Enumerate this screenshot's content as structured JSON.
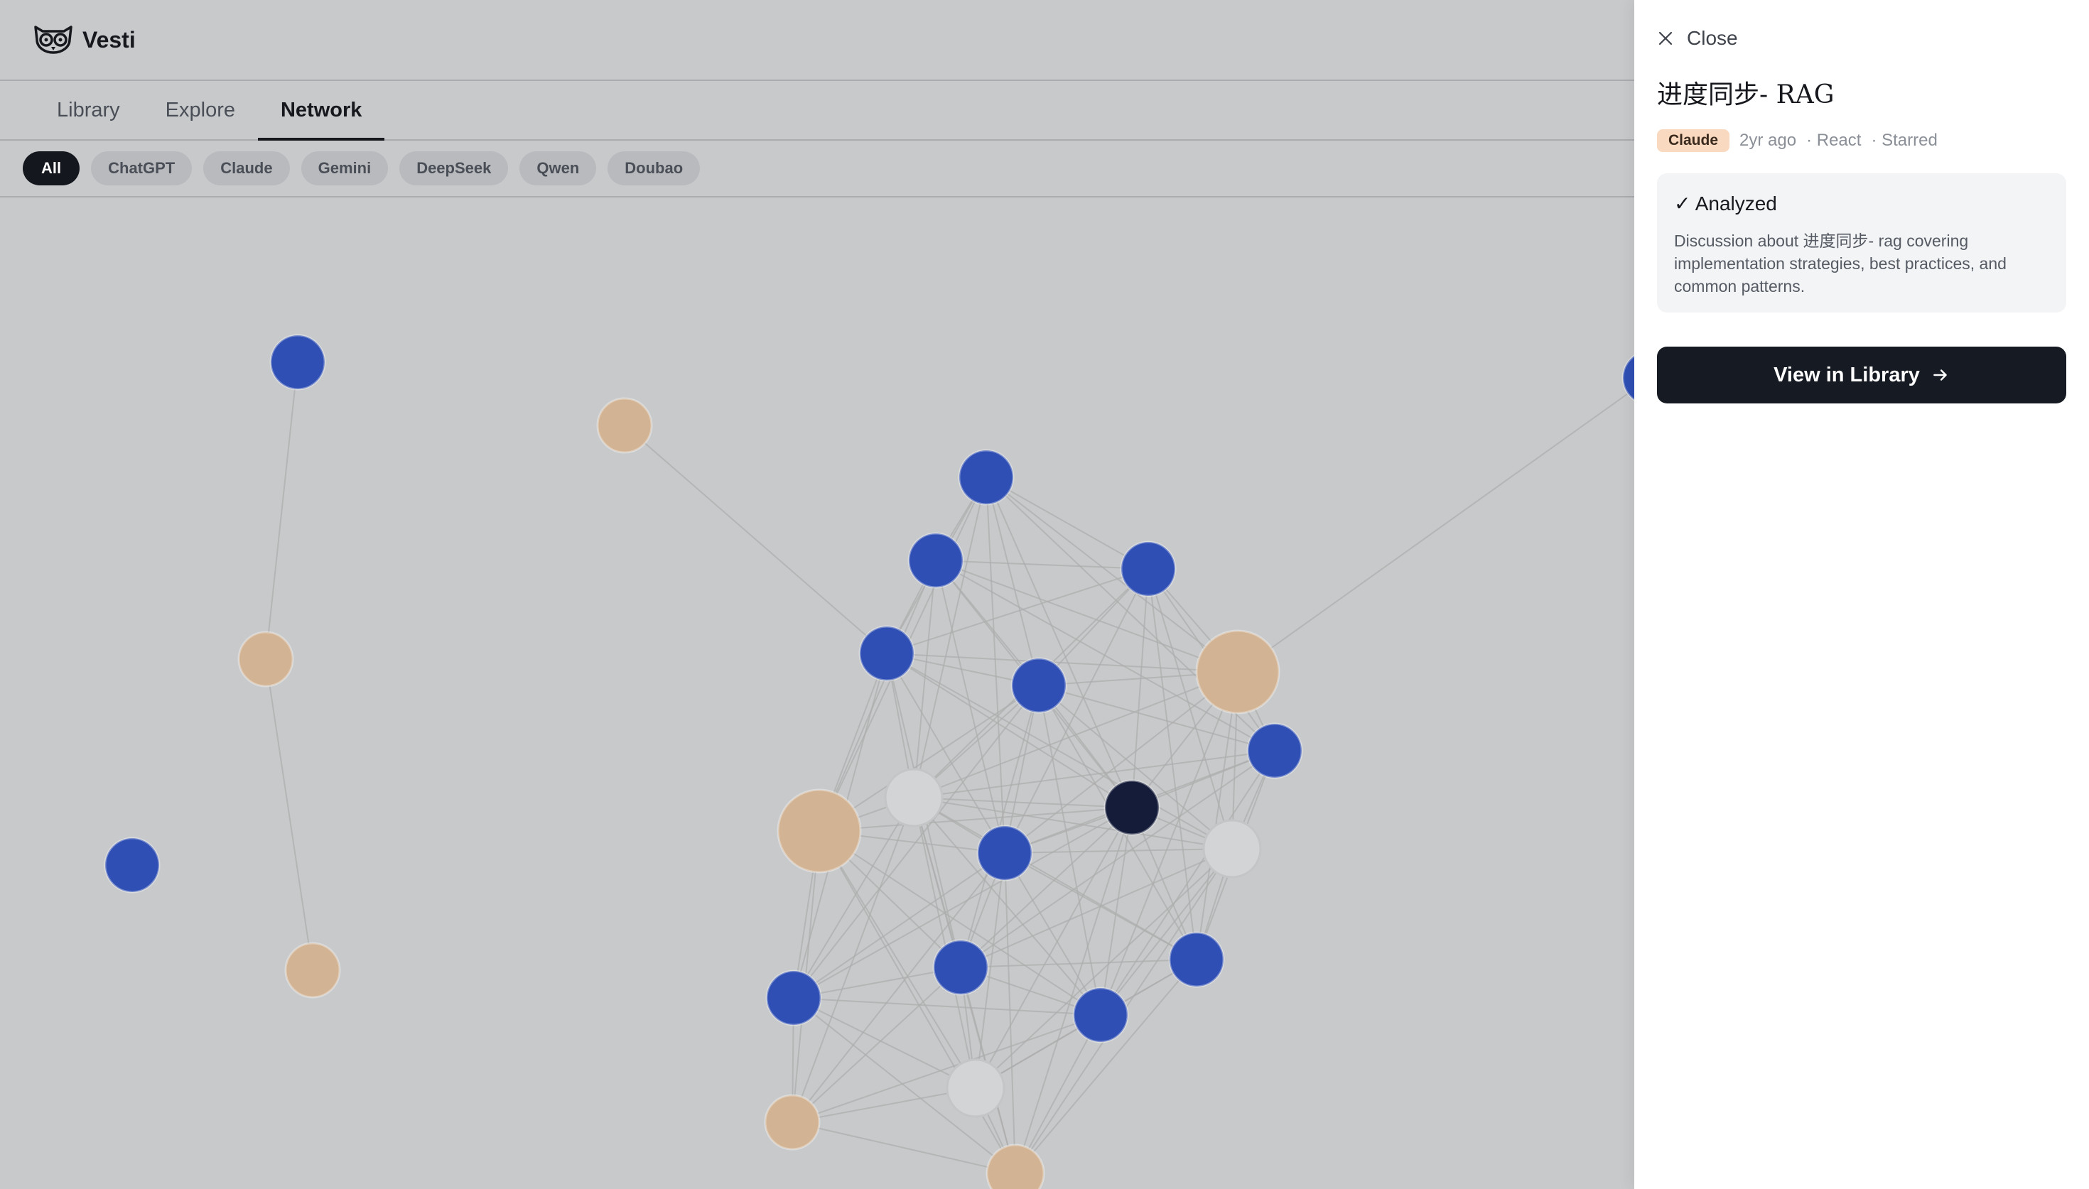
{
  "app": {
    "name": "Vesti"
  },
  "tabs": [
    {
      "label": "Library"
    },
    {
      "label": "Explore"
    },
    {
      "label": "Network",
      "active": true
    }
  ],
  "filters": [
    {
      "label": "All",
      "active": true
    },
    {
      "label": "ChatGPT"
    },
    {
      "label": "Claude"
    },
    {
      "label": "Gemini"
    },
    {
      "label": "DeepSeek"
    },
    {
      "label": "Qwen"
    },
    {
      "label": "Doubao"
    }
  ],
  "colors": {
    "blue_node": "#2f4fb4",
    "tan_node": "#d2b393",
    "grey_node": "#d3d4d6",
    "selected_node": "#141c3a",
    "edge": "#adadad",
    "badge_bg": "#f9d9bf"
  },
  "panel": {
    "close_label": "Close",
    "title": "进度同步- RAG",
    "badge": "Claude",
    "time": "2yr ago",
    "tag": "· React",
    "starred": "· Starred",
    "status_label": "✓ Analyzed",
    "summary": "Discussion about 进度同步- rag covering implementation strategies, best practices, and common patterns.",
    "view_button": "View in Library"
  },
  "icons": {
    "logo": "owl-logo-icon",
    "close": "close-icon",
    "arrow": "arrow-right-icon"
  }
}
